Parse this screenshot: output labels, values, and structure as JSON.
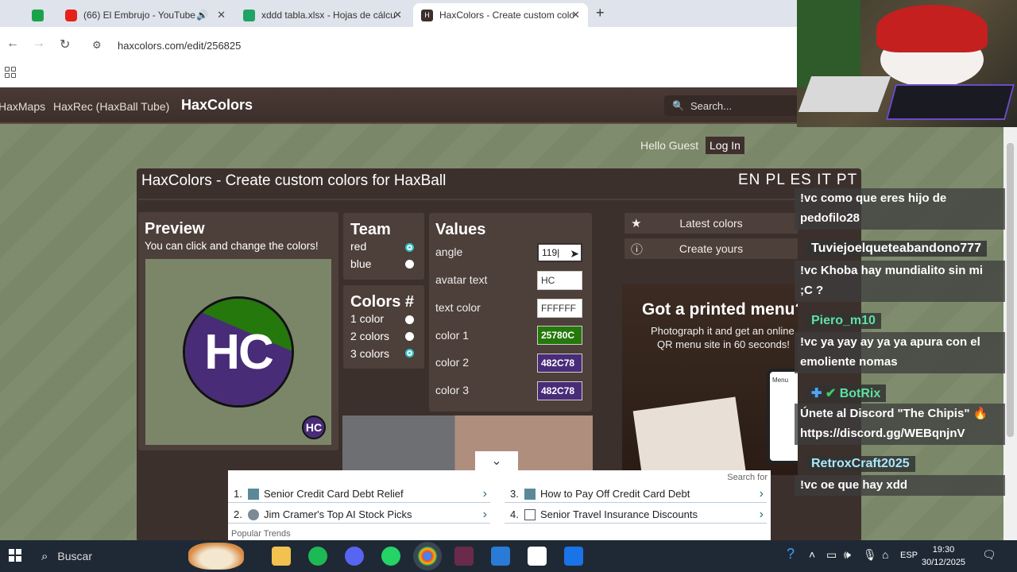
{
  "browser": {
    "tabs": [
      {
        "title": "",
        "color": "#1aa34a"
      },
      {
        "title": "(66) El Embrujo - YouTube",
        "color": "#e62117"
      },
      {
        "title": "xddd tabla.xlsx - Hojas de cálcu",
        "color": "#1fa463"
      },
      {
        "title": "HaxColors - Create custom colo",
        "color": "#3c302c"
      }
    ],
    "url": "haxcolors.com/edit/256825"
  },
  "site": {
    "nav": [
      "HaxMaps",
      "HaxRec (HaxBall Tube)"
    ],
    "brand": "HaxColors",
    "search_placeholder": "Search...",
    "hello": "Hello Guest",
    "login": "Log In",
    "title": "HaxColors - Create custom colors for HaxBall",
    "langs": "EN PL ES IT PT",
    "preview": {
      "heading": "Preview",
      "sub": "You can click and change the colors!",
      "avatar_text": "HC",
      "mini_text": "HC"
    },
    "team": {
      "heading": "Team",
      "options": [
        {
          "label": "red",
          "selected": true
        },
        {
          "label": "blue",
          "selected": false
        }
      ]
    },
    "colors": {
      "heading": "Colors #",
      "options": [
        {
          "label": "1 color",
          "selected": false
        },
        {
          "label": "2 colors",
          "selected": false
        },
        {
          "label": "3 colors",
          "selected": true
        }
      ]
    },
    "values": {
      "heading": "Values",
      "fields": [
        {
          "label": "angle",
          "value": "119|"
        },
        {
          "label": "avatar text",
          "value": "HC"
        },
        {
          "label": "text color",
          "value": "FFFFFF"
        },
        {
          "label": "color 1",
          "value": "25780C"
        },
        {
          "label": "color 2",
          "value": "482C78"
        },
        {
          "label": "color 3",
          "value": "482C78"
        }
      ]
    },
    "side_buttons": [
      "Latest colors",
      "Create yours"
    ],
    "ad": {
      "headline": "Got a printed menu?",
      "line1": "Photograph it and get an online",
      "line2": "QR menu site in 60 seconds!",
      "phone": "Menu"
    },
    "bottom_ad": {
      "search_for": "Search for",
      "items": [
        {
          "n": "1.",
          "text": "Senior Credit Card Debt Relief"
        },
        {
          "n": "3.",
          "text": "How to Pay Off Credit Card Debt"
        },
        {
          "n": "2.",
          "text": "Jim Cramer's Top AI Stock Picks"
        },
        {
          "n": "4.",
          "text": "Senior Travel Insurance Discounts"
        }
      ],
      "footer": "Popular Trends"
    }
  },
  "chat": [
    {
      "name": "",
      "msg1": "!vc como que eres hijo de",
      "msg2": "pedofilo28",
      "color": "#ffffff"
    },
    {
      "name": "Tuviejoelqueteabandono777",
      "msg1": "!vc Khoba hay mundialito sin mi",
      "msg2": ";C ?",
      "color": "#ffffff"
    },
    {
      "name": "Piero_m10",
      "msg1": "!vc ya yay ay ya ya apura con el",
      "msg2": "emoliente nomas",
      "color": "#5fe0a0"
    },
    {
      "name": "BotRix",
      "msg1": "Únete al Discord \"The Chipis\" 🔥",
      "msg2": "https://discord.gg/WEBqnjnV",
      "color": "#5fe0a0"
    },
    {
      "name": "RetroxCraft2025",
      "msg1": "!vc oe que hay xdd",
      "msg2": "",
      "color": "#a8e8ff"
    }
  ],
  "taskbar": {
    "search": "Buscar",
    "lang": "ESP",
    "time": "19:30",
    "date": "30/12/2025"
  }
}
